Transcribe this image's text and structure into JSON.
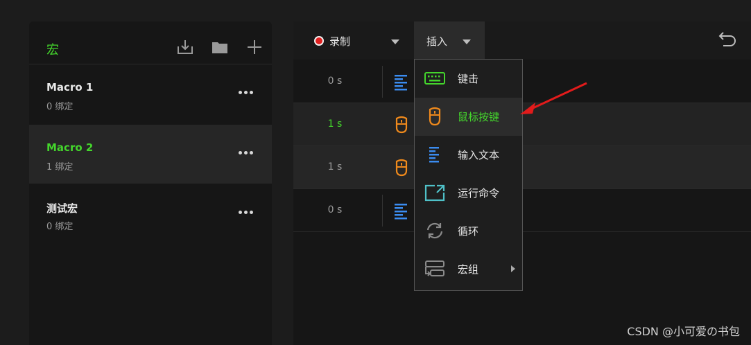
{
  "left_panel": {
    "title": "宏",
    "header_icons": [
      "import-icon",
      "folder-icon",
      "plus-icon"
    ],
    "macros": [
      {
        "name": "Macro 1",
        "sub": "0 绑定",
        "selected": false
      },
      {
        "name": "Macro 2",
        "sub": "1 绑定",
        "selected": true
      },
      {
        "name": "测试宏",
        "sub": "0 绑定",
        "selected": false
      }
    ]
  },
  "toolbar": {
    "record_label": "录制",
    "insert_label": "插入"
  },
  "rows": [
    {
      "time": "0 s",
      "icon": "text-lines-icon"
    },
    {
      "time": "1 s",
      "icon": "mouse-icon"
    },
    {
      "time": "1 s",
      "icon": "mouse-icon"
    },
    {
      "time": "0 s",
      "icon": "text-lines-icon"
    }
  ],
  "insert_menu": [
    {
      "label": "键击",
      "icon": "keyboard-icon"
    },
    {
      "label": "鼠标按键",
      "icon": "mouse-icon",
      "highlighted": true
    },
    {
      "label": "输入文本",
      "icon": "text-lines-icon"
    },
    {
      "label": "运行命令",
      "icon": "run-command-icon"
    },
    {
      "label": "循环",
      "icon": "loop-icon"
    },
    {
      "label": "宏组",
      "icon": "macro-group-icon",
      "has_submenu": true
    }
  ],
  "watermark": "CSDN @小可爱の书包",
  "colors": {
    "accent_green": "#44d62c",
    "mouse_orange": "#f08a1c",
    "text_blue": "#3b8cf0",
    "teal": "#4fc1c8",
    "record_red": "#e02020"
  }
}
